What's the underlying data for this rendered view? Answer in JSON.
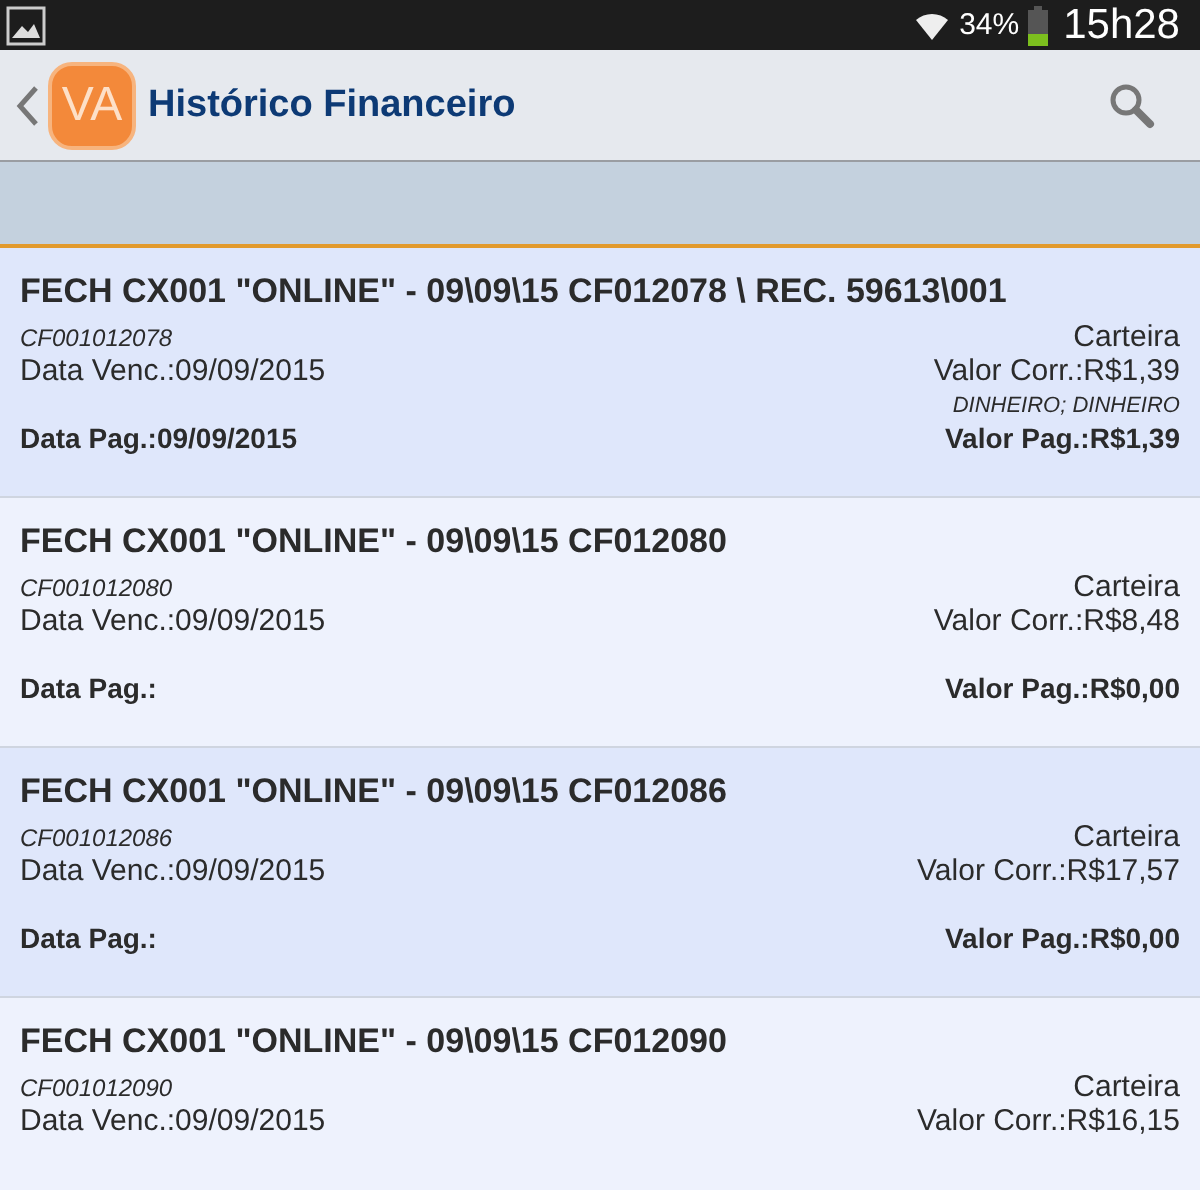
{
  "status_bar": {
    "battery": "34%",
    "time": "15h28"
  },
  "action_bar": {
    "logo": "VA",
    "title": "Histórico Financeiro"
  },
  "entries": [
    {
      "title": "FECH CX001 \"ONLINE\" - 09\\09\\15 CF012078 \\ REC. 59613\\001",
      "code": "CF001012078",
      "account": "Carteira",
      "due": "Data Venc.:09/09/2015",
      "current_value": "Valor Corr.:R$1,39",
      "method": "DINHEIRO; DINHEIRO",
      "paid_date": "Data Pag.:09/09/2015",
      "paid_value": "Valor Pag.:R$1,39"
    },
    {
      "title": "FECH CX001 \"ONLINE\" - 09\\09\\15 CF012080",
      "code": "CF001012080",
      "account": "Carteira",
      "due": "Data Venc.:09/09/2015",
      "current_value": "Valor Corr.:R$8,48",
      "paid_date": "Data Pag.:",
      "paid_value": "Valor Pag.:R$0,00"
    },
    {
      "title": "FECH CX001 \"ONLINE\" - 09\\09\\15 CF012086",
      "code": "CF001012086",
      "account": "Carteira",
      "due": "Data Venc.:09/09/2015",
      "current_value": "Valor Corr.:R$17,57",
      "paid_date": "Data Pag.:",
      "paid_value": "Valor Pag.:R$0,00"
    },
    {
      "title": "FECH CX001 \"ONLINE\" - 09\\09\\15 CF012090",
      "code": "CF001012090",
      "account": "Carteira",
      "due": "Data Venc.:09/09/2015",
      "current_value": "Valor Corr.:R$16,15"
    }
  ]
}
